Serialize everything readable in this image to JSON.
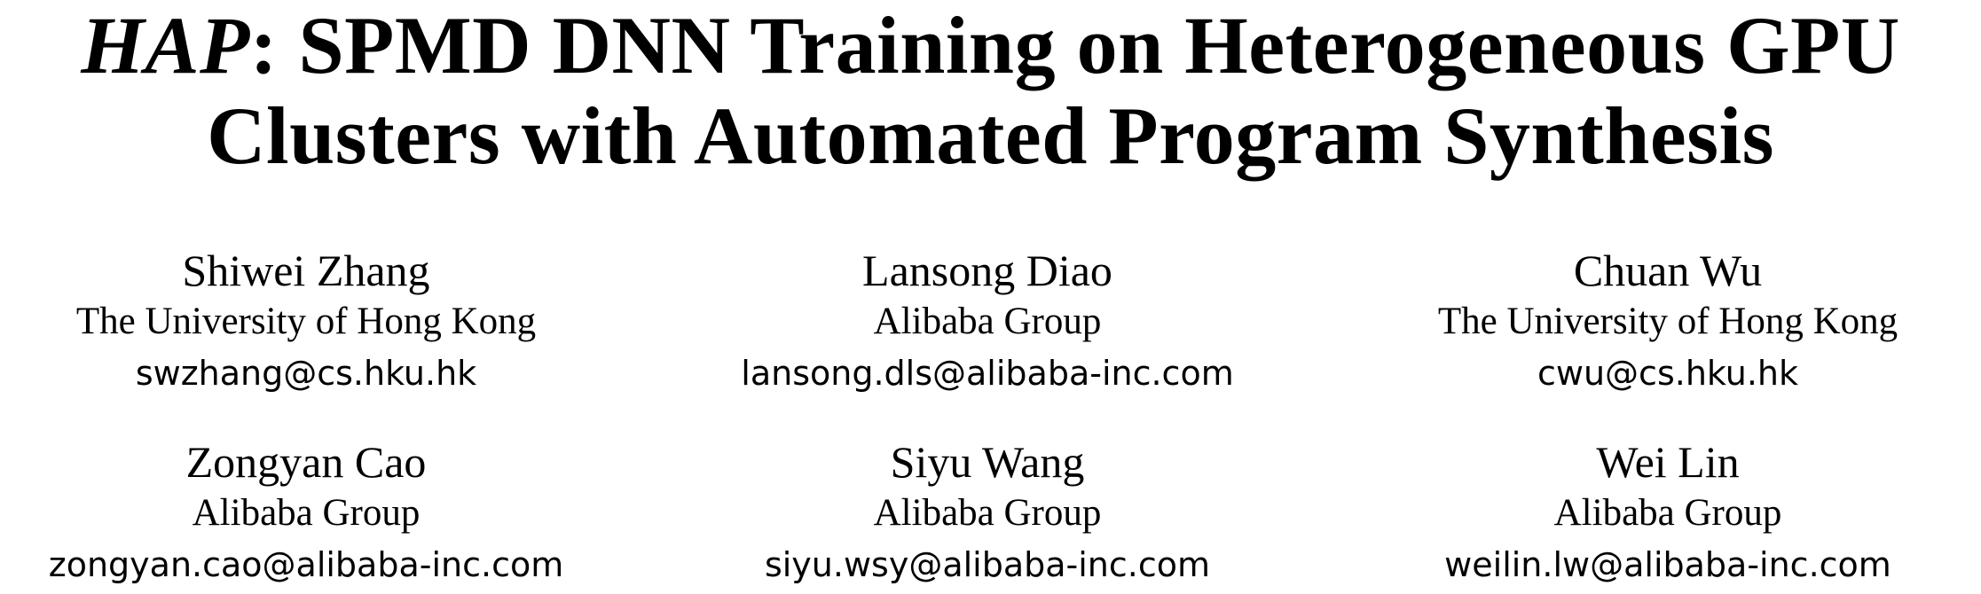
{
  "title": {
    "italic_part": "HAP",
    "line1_rest": ": SPMD DNN Training on Heterogeneous GPU",
    "line2": "Clusters with Automated Program Synthesis"
  },
  "authors": [
    {
      "name": "Shiwei Zhang",
      "affiliation": "The University of Hong Kong",
      "email": "swzhang@cs.hku.hk"
    },
    {
      "name": "Lansong Diao",
      "affiliation": "Alibaba Group",
      "email": "lansong.dls@alibaba-inc.com"
    },
    {
      "name": "Chuan Wu",
      "affiliation": "The University of Hong Kong",
      "email": "cwu@cs.hku.hk"
    },
    {
      "name": "Zongyan Cao",
      "affiliation": "Alibaba Group",
      "email": "zongyan.cao@alibaba-inc.com"
    },
    {
      "name": "Siyu Wang",
      "affiliation": "Alibaba Group",
      "email": "siyu.wsy@alibaba-inc.com"
    },
    {
      "name": "Wei Lin",
      "affiliation": "Alibaba Group",
      "email": "weilin.lw@alibaba-inc.com"
    }
  ]
}
